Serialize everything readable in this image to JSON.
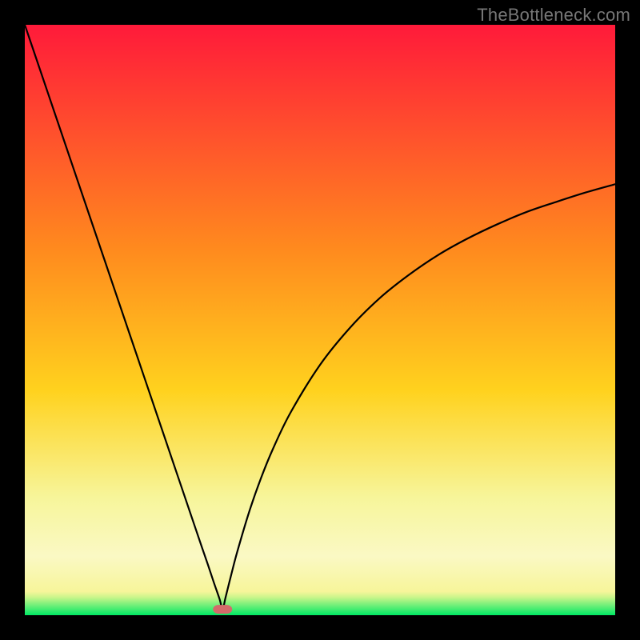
{
  "watermark": "TheBottleneck.com",
  "colors": {
    "frame": "#000000",
    "curve": "#000000",
    "marker_fill": "#d46a6a",
    "marker_stroke": "#c05050",
    "grad_top": "#ff1a3a",
    "grad_mid1": "#ff8a1e",
    "grad_mid2": "#ffd21e",
    "grad_mid3": "#f7f59a",
    "grad_lightband": "#faf9c4",
    "grad_green": "#00e864"
  },
  "chart_data": {
    "type": "line",
    "title": "",
    "xlabel": "",
    "ylabel": "",
    "xlim": [
      0,
      100
    ],
    "ylim": [
      0,
      100
    ],
    "min_marker": {
      "x": 33.5,
      "y": 1.0
    },
    "series": [
      {
        "name": "bottleneck-curve",
        "x": [
          0,
          2,
          4,
          6,
          8,
          10,
          12,
          14,
          16,
          18,
          20,
          22,
          24,
          26,
          28,
          30,
          31,
          32,
          33,
          33.5,
          34,
          35,
          36,
          38,
          40,
          42,
          45,
          50,
          55,
          60,
          65,
          70,
          75,
          80,
          85,
          90,
          95,
          100
        ],
        "y": [
          100,
          94.1,
          88.2,
          82.3,
          76.4,
          70.5,
          64.6,
          58.7,
          52.8,
          46.9,
          41.0,
          35.1,
          29.2,
          23.3,
          17.4,
          11.5,
          8.6,
          5.6,
          2.7,
          1.0,
          3.0,
          7.0,
          10.8,
          17.5,
          23.2,
          28.1,
          34.3,
          42.4,
          48.6,
          53.6,
          57.6,
          61.0,
          63.8,
          66.2,
          68.3,
          70.0,
          71.6,
          73.0
        ]
      }
    ]
  }
}
